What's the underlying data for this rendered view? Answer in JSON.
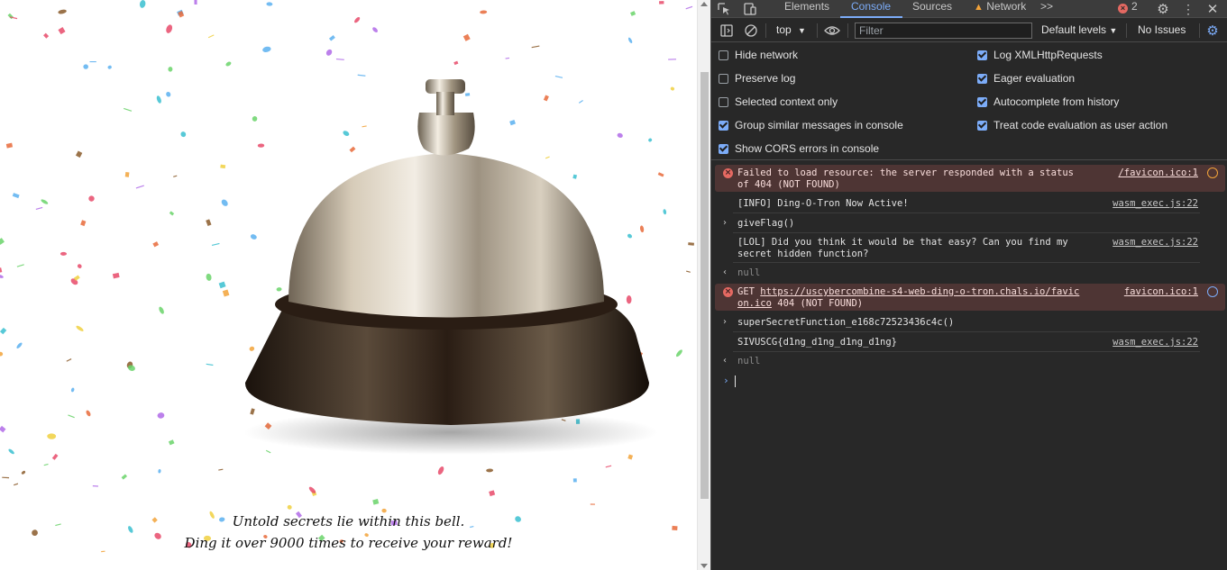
{
  "page": {
    "caption_line1": "Untold secrets lie within this bell.",
    "caption_line2": "Ding it over 9000 times to receive your reward!"
  },
  "devtools": {
    "tabs": [
      {
        "label": "Elements",
        "active": false
      },
      {
        "label": "Console",
        "active": true
      },
      {
        "label": "Sources",
        "active": false
      },
      {
        "label": "Network",
        "active": false,
        "warning": true
      }
    ],
    "more_tabs_icon": ">>",
    "error_count": "2",
    "toolbar": {
      "context": "top",
      "filter_placeholder": "Filter",
      "levels": "Default levels",
      "issues": "No Issues"
    },
    "settings": {
      "left": [
        {
          "label": "Hide network",
          "checked": false
        },
        {
          "label": "Preserve log",
          "checked": false
        },
        {
          "label": "Selected context only",
          "checked": false
        },
        {
          "label": "Group similar messages in console",
          "checked": true
        },
        {
          "label": "Show CORS errors in console",
          "checked": true
        }
      ],
      "right": [
        {
          "label": "Log XMLHttpRequests",
          "checked": true
        },
        {
          "label": "Eager evaluation",
          "checked": true
        },
        {
          "label": "Autocomplete from history",
          "checked": true
        },
        {
          "label": "Treat code evaluation as user action",
          "checked": true
        }
      ]
    },
    "console": [
      {
        "type": "error",
        "line1": "Failed to load resource: the server responded with a status",
        "line2": "of 404 (NOT FOUND)",
        "source": "/favicon.ico:1"
      },
      {
        "type": "log",
        "text": "[INFO] Ding-O-Tron Now Active!",
        "source": "wasm_exec.js:22"
      },
      {
        "type": "input",
        "text": "giveFlag()"
      },
      {
        "type": "log",
        "line1": "[LOL] Did you think it would be that easy? Can you find my",
        "line2": "secret hidden function?",
        "source": "wasm_exec.js:22"
      },
      {
        "type": "result",
        "text": "null"
      },
      {
        "type": "error",
        "prefix": "GET ",
        "url1": "https://uscybercombine-s4-web-ding-o-tron.chals.io/favic",
        "url2": "on.ico",
        "suffix": " 404 (NOT FOUND)",
        "source": "favicon.ico:1"
      },
      {
        "type": "input",
        "text": "superSecretFunction_e168c72523436c4c()"
      },
      {
        "type": "log",
        "text": "SIVUSCG{d1ng_d1ng_d1ng_d1ng}",
        "source": "wasm_exec.js:22"
      },
      {
        "type": "result",
        "text": "null"
      }
    ]
  },
  "colors": {
    "devtools_bg": "#282828",
    "accent": "#7cacf8",
    "error_bg": "#4e3534",
    "error_icon": "#e46962"
  }
}
